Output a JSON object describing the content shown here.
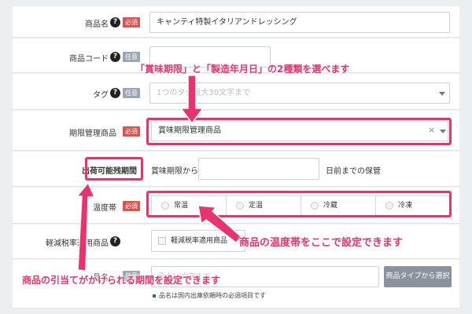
{
  "badges": {
    "required": "必須",
    "optional": "任意"
  },
  "help_glyph": "?",
  "product_name": {
    "label": "商品名",
    "value": "キャンティ特製イタリアンドレッシング"
  },
  "product_code": {
    "label": "商品コード",
    "value": ""
  },
  "tag": {
    "label": "タグ",
    "placeholder": "1つのタグ最大30文字まで"
  },
  "expiry_management": {
    "label": "期限管理商品",
    "value": "賞味期限管理商品",
    "clear": "×"
  },
  "shippable_period": {
    "label": "出荷可能残期間",
    "prefix": "賞味期限から",
    "value": "",
    "suffix": "日前までの保管"
  },
  "temperature": {
    "label": "温度帯",
    "options": [
      "常温",
      "定温",
      "冷蔵",
      "冷凍"
    ]
  },
  "reduced_tax": {
    "label": "軽減税率適用商品",
    "checkbox_label": "軽減税率適用商品"
  },
  "item_name": {
    "label": "品名",
    "placeholder": "最大16文字まで",
    "button": "商品タイプから選択",
    "note": "品名は国内出庫依頼時の必須項目です"
  },
  "annotations": {
    "expiry_types": "「賞味期限」と「製造年月日」の2種類を選べます",
    "temperature_note": "商品の温度帯をここで設定できます",
    "shipping_note": "商品の引当てがかけられる期間を設定できます"
  },
  "colors": {
    "accent": "#e8336e",
    "required_badge": "#d9534f",
    "optional_badge": "#9aa6b2"
  }
}
